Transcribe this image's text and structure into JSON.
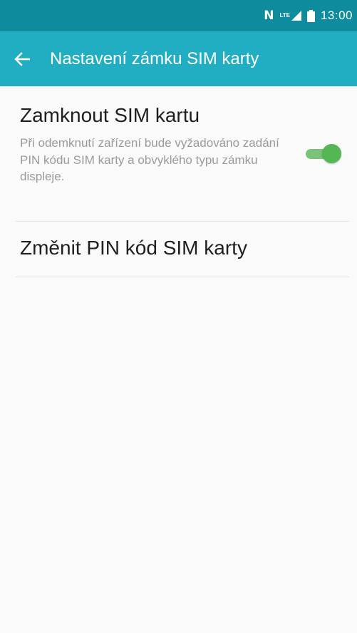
{
  "status_bar": {
    "nfc_icon": "nfc-icon",
    "network_label": "LTE",
    "signal_icon": "signal-icon",
    "battery_icon": "battery-icon",
    "time": "13:00"
  },
  "app_bar": {
    "back_icon": "arrow-left-icon",
    "title": "Nastavení zámku SIM karty"
  },
  "settings": {
    "lock_sim": {
      "title": "Zamknout SIM kartu",
      "description": "Při odemknutí zařízení bude vyžadováno zadání PIN kódu SIM karty a obvyklého typu zámku displeje.",
      "enabled": true
    },
    "change_pin": {
      "title": "Změnit PIN kód SIM karty"
    }
  },
  "colors": {
    "status_bar": "#0e8c9e",
    "app_bar": "#22aec2",
    "background": "#fafafa",
    "toggle_on": "#55b656"
  }
}
